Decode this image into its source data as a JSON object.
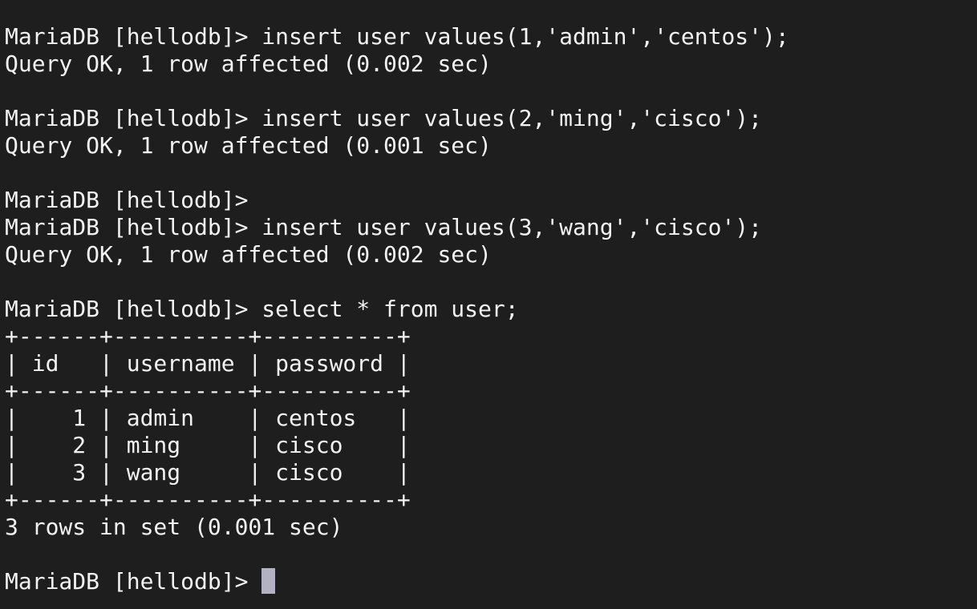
{
  "terminal": {
    "colors": {
      "background": "#1e1e1e",
      "foreground": "#f2f2f2",
      "cursor": "#b2b2c2"
    },
    "lines": [
      "MariaDB [hellodb]> insert user values(1,'admin','centos');",
      "Query OK, 1 row affected (0.002 sec)",
      "",
      "MariaDB [hellodb]> insert user values(2,'ming','cisco');",
      "Query OK, 1 row affected (0.001 sec)",
      "",
      "MariaDB [hellodb]>",
      "MariaDB [hellodb]> insert user values(3,'wang','cisco');",
      "Query OK, 1 row affected (0.002 sec)",
      "",
      "MariaDB [hellodb]> select * from user;",
      "+------+----------+----------+",
      "| id   | username | password |",
      "+------+----------+----------+",
      "|    1 | admin    | centos   |",
      "|    2 | ming     | cisco    |",
      "|    3 | wang     | cisco    |",
      "+------+----------+----------+",
      "3 rows in set (0.001 sec)",
      ""
    ],
    "prompt": "MariaDB [hellodb]> "
  }
}
